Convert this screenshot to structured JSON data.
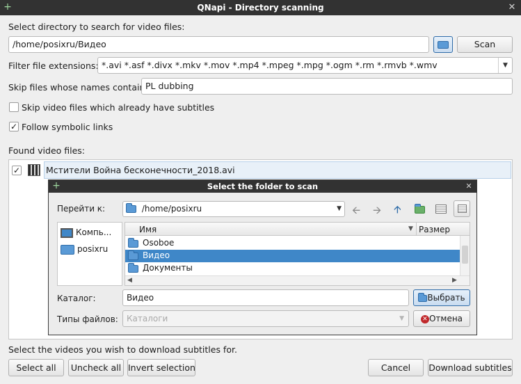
{
  "window": {
    "title": "QNapi - Directory scanning"
  },
  "dir_label": "Select directory to search for video files:",
  "dir_value": "/home/posixru/Видео",
  "scan_label": "Scan",
  "ext_label": "Filter file extensions:",
  "ext_value": "*.avi *.asf *.divx *.mkv *.mov *.mp4 *.mpeg *.mpg *.ogm *.rm *.rmvb *.wmv",
  "skip_label": "Skip files whose names contain:",
  "skip_value": "PL dubbing",
  "opt_skip_subs": {
    "label": "Skip video files which already have subtitles",
    "checked": false
  },
  "opt_symlinks": {
    "label": "Follow symbolic links",
    "checked": true
  },
  "found_label": "Found video files:",
  "found_files": [
    {
      "name": "Мстители Война бесконечности_2018.avi",
      "checked": true
    }
  ],
  "hint": "Select the videos you wish to download subtitles for.",
  "buttons": {
    "select_all": "Select all",
    "uncheck_all": "Uncheck all",
    "invert": "Invert selection",
    "cancel": "Cancel",
    "download": "Download subtitles"
  },
  "dialog": {
    "title": "Select the folder to scan",
    "goto_label": "Перейти к:",
    "goto_value": "/home/posixru",
    "places": [
      "Компь...",
      "posixru"
    ],
    "col_name": "Имя",
    "col_size": "Размер",
    "entries": [
      "Osoboe",
      "Видео",
      "Документы"
    ],
    "selected_entry": "Видео",
    "catalog_label": "Каталог:",
    "catalog_value": "Видео",
    "types_label": "Типы файлов:",
    "types_value": "Каталоги",
    "choose": "Выбрать",
    "cancel": "Отмена"
  },
  "colors": {
    "titlebar": "#323232",
    "selection": "#3f87c8",
    "accent": "#2f6ca8"
  }
}
